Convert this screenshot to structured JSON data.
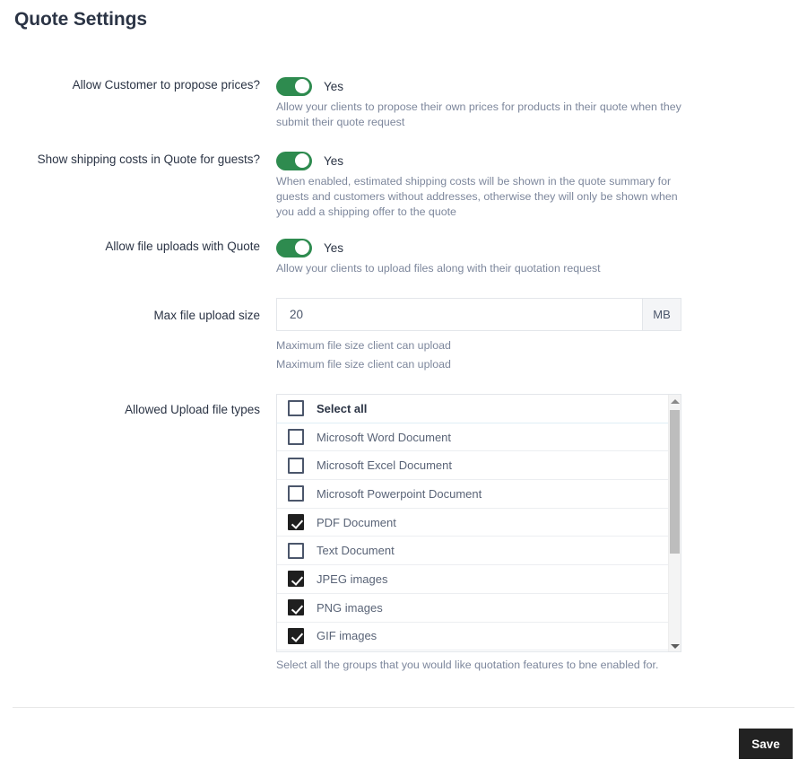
{
  "page": {
    "title": "Quote Settings"
  },
  "colors": {
    "toggle_on": "#2e8b4f",
    "checkbox_checked": "#1f1f1f",
    "save_button_bg": "#222222",
    "title_text": "#2b3445",
    "help_text": "#7d879c"
  },
  "rows": [
    {
      "label": "Allow Customer to propose prices?",
      "toggle_state": "Yes",
      "help": "Allow your clients to propose their own prices for products in their quote when they submit their quote request"
    },
    {
      "label": "Show shipping costs in Quote for guests?",
      "toggle_state": "Yes",
      "help": "When enabled, estimated shipping costs will be shown in the quote summary for guests and customers without addresses, otherwise they will only be shown when you add a shipping offer to the quote"
    },
    {
      "label": "Allow file uploads with Quote",
      "toggle_state": "Yes",
      "help": "Allow your clients to upload files along with their quotation request"
    }
  ],
  "max_upload": {
    "label": "Max file upload size",
    "value": "20",
    "placeholder": "",
    "suffix": "MB",
    "help_line_1": "Maximum file size client can upload",
    "help_line_2": "Maximum file size client can upload"
  },
  "file_types": {
    "label": "Allowed Upload file types",
    "select_all_label": "Select all",
    "select_all_checked": false,
    "items": [
      {
        "label": "Microsoft Word Document",
        "checked": false
      },
      {
        "label": "Microsoft Excel Document",
        "checked": false
      },
      {
        "label": "Microsoft Powerpoint Document",
        "checked": false
      },
      {
        "label": "PDF Document",
        "checked": true
      },
      {
        "label": "Text Document",
        "checked": false
      },
      {
        "label": "JPEG images",
        "checked": true
      },
      {
        "label": "PNG images",
        "checked": true
      },
      {
        "label": "GIF images",
        "checked": true
      }
    ],
    "footnote": "Select all the groups that you would like quotation features to bne enabled for."
  },
  "footer": {
    "save_label": "Save"
  }
}
